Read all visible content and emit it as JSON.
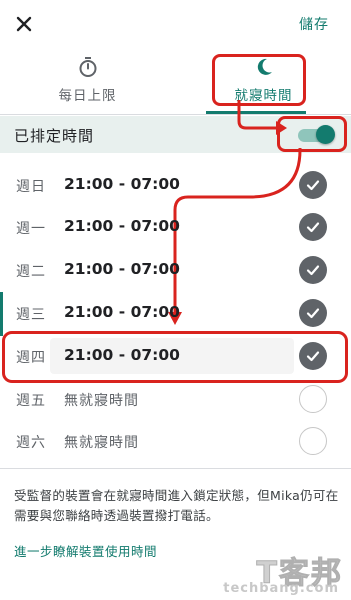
{
  "header": {
    "save_label": "儲存"
  },
  "tabs": [
    {
      "label": "每日上限",
      "icon": "timer-icon",
      "selected": false
    },
    {
      "label": "就寢時間",
      "icon": "moon-icon",
      "selected": true
    }
  ],
  "schedule": {
    "title": "已排定時間",
    "enabled": true
  },
  "days": [
    {
      "day": "週日",
      "time": "21:00 - 07:00",
      "checked": true
    },
    {
      "day": "週一",
      "time": "21:00 - 07:00",
      "checked": true
    },
    {
      "day": "週二",
      "time": "21:00 - 07:00",
      "checked": true
    },
    {
      "day": "週三",
      "time": "21:00 - 07:00",
      "checked": true
    },
    {
      "day": "週四",
      "time": "21:00 - 07:00",
      "checked": true
    },
    {
      "day": "週五",
      "time": "無就寢時間",
      "checked": false
    },
    {
      "day": "週六",
      "time": "無就寢時間",
      "checked": false
    }
  ],
  "footer": {
    "description": "受監督的裝置會在就寢時間進入鎖定狀態，但Mika仍可在需要與您聯絡時透過裝置撥打電話。",
    "link": "進一步瞭解裝置使用時間"
  },
  "watermark": {
    "cn": "T客邦",
    "en": "techbang.com"
  },
  "colors": {
    "accent": "#137b6e",
    "annotation": "#d9231e"
  }
}
